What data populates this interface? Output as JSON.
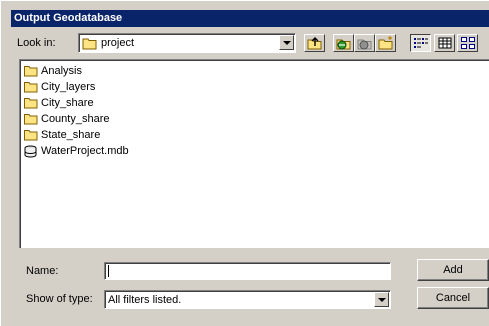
{
  "window": {
    "title": "Output Geodatabase"
  },
  "lookin": {
    "label": "Look in:",
    "value": "project"
  },
  "toolbar": {
    "icons": [
      "up-one-level-icon",
      "connect-folder-icon",
      "disconnect-folder-icon",
      "new-folder-icon",
      "list-view-icon",
      "details-view-icon",
      "thumbnails-view-icon"
    ]
  },
  "files": [
    {
      "name": "Analysis",
      "icon": "folder-icon"
    },
    {
      "name": "City_layers",
      "icon": "folder-icon"
    },
    {
      "name": "City_share",
      "icon": "folder-icon"
    },
    {
      "name": "County_share",
      "icon": "folder-icon"
    },
    {
      "name": "State_share",
      "icon": "folder-icon"
    },
    {
      "name": "WaterProject.mdb",
      "icon": "geodatabase-icon"
    }
  ],
  "name_field": {
    "label": "Name:",
    "value": ""
  },
  "type_field": {
    "label": "Show of type:",
    "value": "All filters listed."
  },
  "buttons": {
    "add": "Add",
    "cancel": "Cancel"
  },
  "colors": {
    "titlebar": "#0a246a",
    "dialog": "#d4d0c8",
    "folder": "#ffe484"
  }
}
